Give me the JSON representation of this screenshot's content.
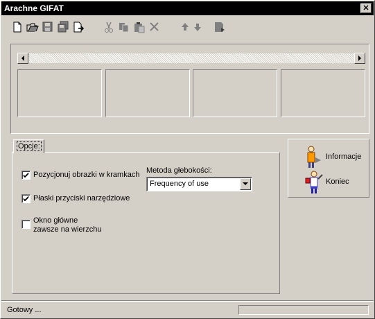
{
  "window": {
    "title": "Arachne GIFAT",
    "close_glyph": "✕"
  },
  "toolbar": {
    "buttons": [
      "new-icon",
      "open-icon",
      "save-icon",
      "save-all-icon",
      "export-icon",
      "cut-icon",
      "copy-icon",
      "paste-icon",
      "delete-icon",
      "move-up-icon",
      "move-down-icon",
      "properties-icon"
    ]
  },
  "tabs": [
    {
      "label": "Opcje:"
    }
  ],
  "options": {
    "checkboxes": [
      {
        "label": "Pozycjonuj obrazki w kramkach",
        "checked": true
      },
      {
        "label": "Płaski przyciski narzędziowe",
        "checked": true
      },
      {
        "label_line1": "Okno główne",
        "label_line2": "zawsze na wierzchu",
        "checked": false
      }
    ],
    "depth_method_label": "Metoda głebokości:",
    "depth_method_value": "Frequency of use"
  },
  "side_buttons": {
    "info": "Informacje",
    "exit": "Koniec"
  },
  "status": {
    "text": "Gotowy ...",
    "progress": 0
  },
  "colors": {
    "face": "#d4d0c8",
    "title_bg": "#000000",
    "title_fg": "#ffffff"
  }
}
